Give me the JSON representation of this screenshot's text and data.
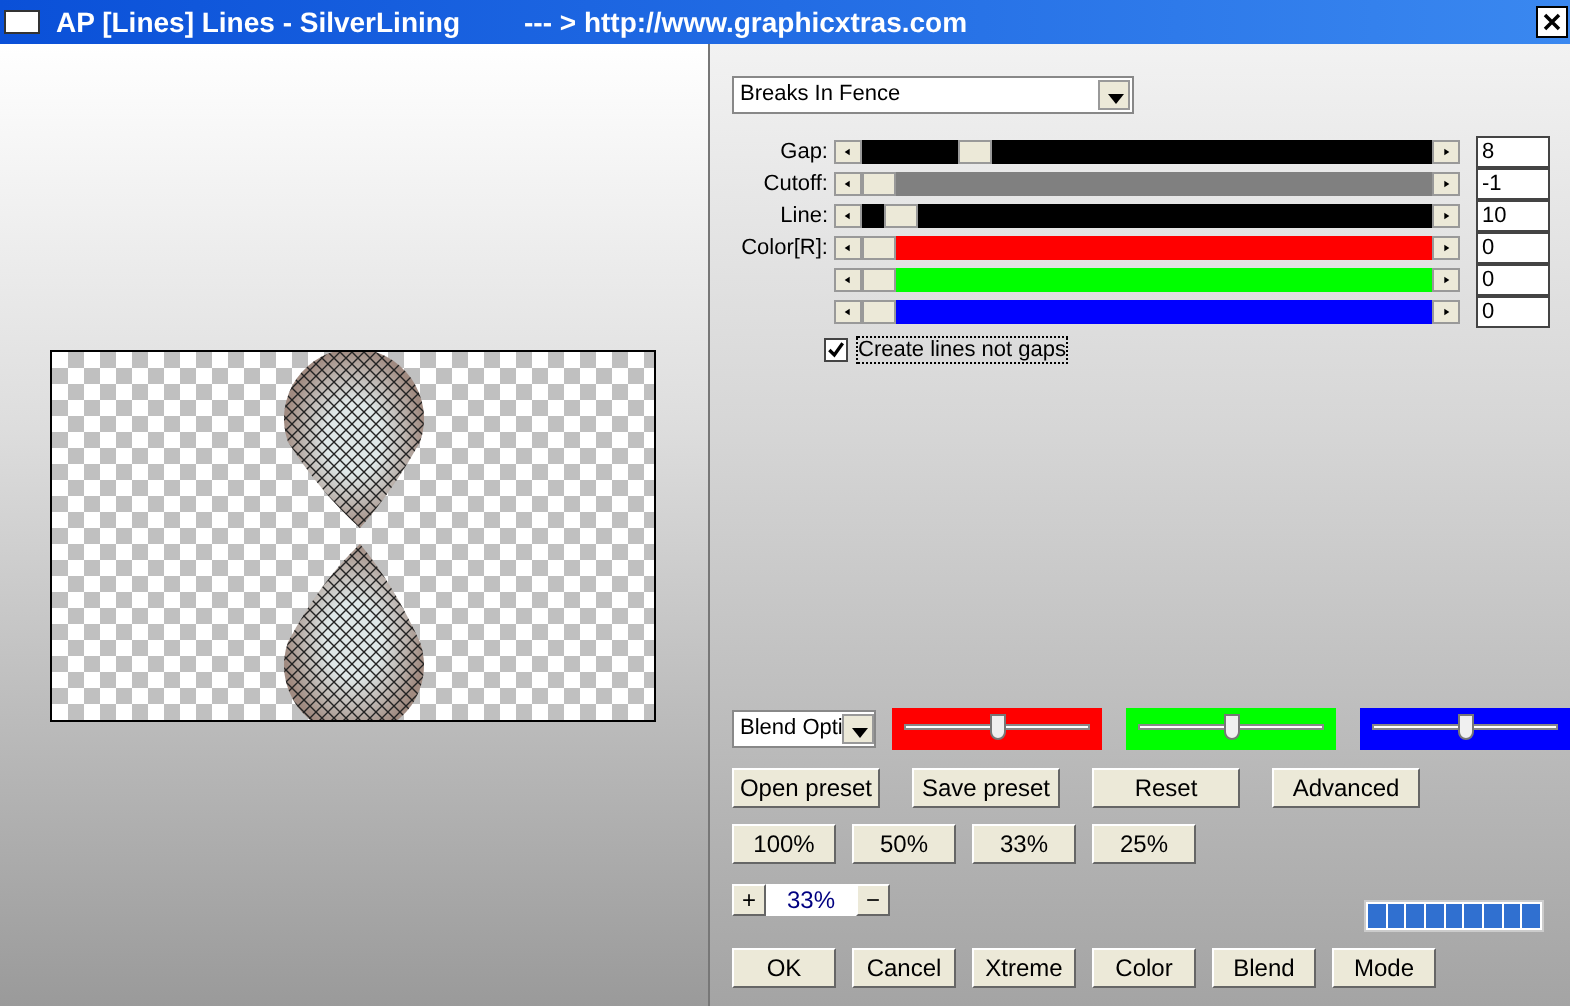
{
  "window": {
    "title": "AP [Lines]  Lines - SilverLining",
    "link": "--- > http://www.graphicxtras.com"
  },
  "effect_select": {
    "value": "Breaks In Fence"
  },
  "sliders": [
    {
      "label": "Gap:",
      "value": "8",
      "level": 0.18,
      "color": "#000000"
    },
    {
      "label": "Cutoff:",
      "value": "-1",
      "level": 0,
      "color": "#808080"
    },
    {
      "label": "Line:",
      "value": "10",
      "level": 0.04,
      "color": "#000000"
    },
    {
      "label": "Color[R]:",
      "value": "0",
      "level": 0,
      "color": "#ff0000"
    },
    {
      "value": "0",
      "level": 0,
      "color": "#00ff00"
    },
    {
      "value": "0",
      "level": 0,
      "color": "#0000ff"
    }
  ],
  "create_lines": {
    "label": "Create lines not gaps",
    "checked": true
  },
  "blend_select": {
    "value": "Blend Opti"
  },
  "blend_sliders": [
    {
      "color": "#ff0000",
      "level": 0.5
    },
    {
      "color": "#00ff00",
      "level": 0.5
    },
    {
      "color": "#0000ff",
      "level": 0.5
    }
  ],
  "preset_buttons": [
    "Open preset",
    "Save preset",
    "Reset",
    "Advanced"
  ],
  "zoom_buttons": [
    "100%",
    "50%",
    "33%",
    "25%"
  ],
  "zoom": {
    "plus": "+",
    "value": "33%",
    "minus": "−"
  },
  "progress": {
    "level": 1
  },
  "action_buttons": [
    "OK",
    "Cancel",
    "Xtreme",
    "Color",
    "Blend",
    "Mode"
  ]
}
